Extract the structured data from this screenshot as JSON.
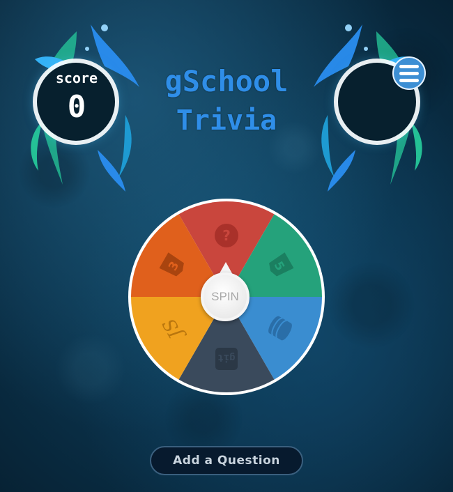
{
  "game": {
    "title_line1": "gSchool",
    "title_line2": "Trivia"
  },
  "score": {
    "label": "score",
    "value": "0"
  },
  "menu": {
    "icon": "hamburger-menu-icon"
  },
  "wheel": {
    "spin_label": "SPIN",
    "segments": [
      {
        "category": "question",
        "icon": "question-mark-icon",
        "color": "#c9463d"
      },
      {
        "category": "html5",
        "icon": "html5-icon",
        "color": "#25a27b"
      },
      {
        "category": "database",
        "icon": "database-icon",
        "color": "#3a8dd0"
      },
      {
        "category": "git",
        "icon": "git-icon",
        "color": "#3a4a5c"
      },
      {
        "category": "javascript",
        "icon": "js-icon",
        "color": "#f0a21f"
      },
      {
        "category": "css3",
        "icon": "css3-icon",
        "color": "#e0601c"
      }
    ]
  },
  "actions": {
    "add_question_label": "Add a Question"
  },
  "colors": {
    "title": "#2f8ee8",
    "background": "#0a3048",
    "splash_blue": "#2a8ef0",
    "splash_green": "#2fd6a0"
  }
}
